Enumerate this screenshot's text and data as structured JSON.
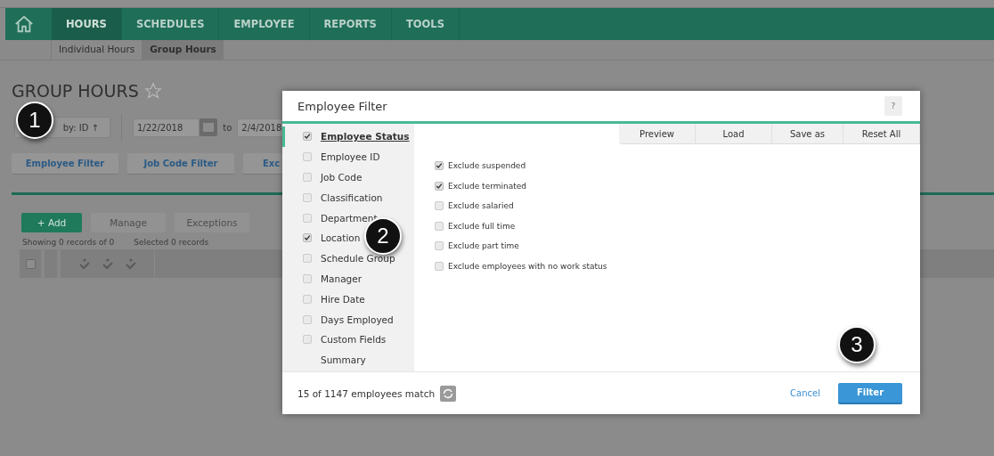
{
  "nav": {
    "tabs": [
      {
        "label": "HOURS",
        "selected": true
      },
      {
        "label": "SCHEDULES",
        "selected": false
      },
      {
        "label": "EMPLOYEE",
        "selected": false
      },
      {
        "label": "REPORTS",
        "selected": false
      },
      {
        "label": "TOOLS",
        "selected": false
      }
    ]
  },
  "subnav": {
    "tabs": [
      {
        "label": "Individual Hours",
        "selected": false
      },
      {
        "label": "Group Hours",
        "selected": true
      }
    ]
  },
  "page": {
    "title": "GROUP HOURS",
    "sort_button": "by: ID ↑",
    "date_from": "1/22/2018",
    "date_sep": "to",
    "date_to": "2/4/2018",
    "filter_buttons": [
      "Employee Filter",
      "Job Code Filter",
      "Exc"
    ],
    "actions": [
      {
        "label": "+ Add",
        "disabled": false
      },
      {
        "label": "Manage",
        "disabled": true
      },
      {
        "label": "Exceptions",
        "disabled": true
      }
    ],
    "select_all": {
      "checked": false
    },
    "records_shown": "Showing 0 records of 0",
    "records_selected": "Selected 0 records"
  },
  "modal": {
    "title": "Employee Filter",
    "help": "?",
    "categories": [
      {
        "kind": "check",
        "label": "Employee Status",
        "checked": true,
        "selected": true
      },
      {
        "kind": "check",
        "label": "Employee ID",
        "checked": false,
        "selected": false
      },
      {
        "kind": "check",
        "label": "Job Code",
        "checked": false,
        "selected": false
      },
      {
        "kind": "check",
        "label": "Classification",
        "checked": false,
        "selected": false
      },
      {
        "kind": "check",
        "label": "Department",
        "checked": false,
        "selected": false
      },
      {
        "kind": "check",
        "label": "Location",
        "checked": true,
        "selected": false
      },
      {
        "kind": "check",
        "label": "Schedule Group",
        "checked": false,
        "selected": false
      },
      {
        "kind": "check",
        "label": "Manager",
        "checked": false,
        "selected": false
      },
      {
        "kind": "check",
        "label": "Hire Date",
        "checked": false,
        "selected": false
      },
      {
        "kind": "check",
        "label": "Days Employed",
        "checked": false,
        "selected": false
      },
      {
        "kind": "check",
        "label": "Custom Fields",
        "checked": false,
        "selected": false
      },
      {
        "kind": "plain",
        "label": "Summary",
        "selected": false
      }
    ],
    "toolbar": [
      "Preview",
      "Load",
      "Save as",
      "Reset All"
    ],
    "options": [
      {
        "label": "Exclude suspended",
        "checked": true
      },
      {
        "label": "Exclude terminated",
        "checked": true
      },
      {
        "label": "Exclude salaried",
        "checked": false
      },
      {
        "label": "Exclude full time",
        "checked": false
      },
      {
        "label": "Exclude part time",
        "checked": false
      },
      {
        "label": "Exclude employees with no work status",
        "checked": false
      }
    ],
    "match": "15 of 1147 employees match",
    "cancel": "Cancel",
    "submit": "Filter"
  },
  "callouts": [
    "1",
    "2",
    "3"
  ]
}
